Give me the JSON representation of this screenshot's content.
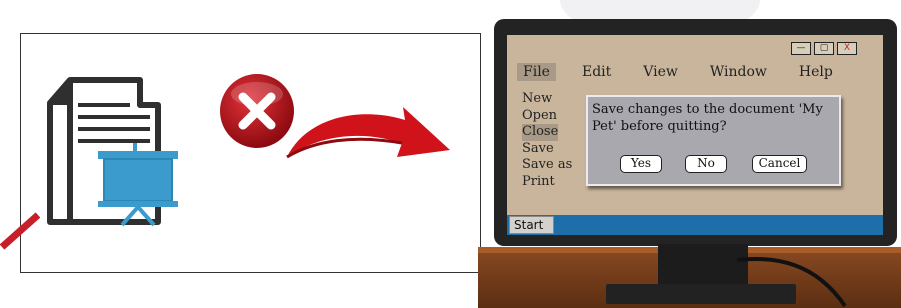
{
  "window_controls": {
    "minimize": "—",
    "maximize": "▢",
    "close": "X"
  },
  "menubar": {
    "items": [
      "File",
      "Edit",
      "View",
      "Window",
      "Help"
    ]
  },
  "file_menu": {
    "items": [
      "New",
      "Open",
      "Close",
      "Save",
      "Save as",
      "Print"
    ],
    "highlighted": "Close"
  },
  "dialog": {
    "message": "Save changes to the document 'My Pet' before quitting?",
    "buttons": {
      "yes": "Yes",
      "no": "No",
      "cancel": "Cancel"
    }
  },
  "taskbar": {
    "start_label": "Start"
  },
  "colors": {
    "screen_bg": "#c9b59b",
    "taskbar": "#1e6fa9",
    "dialog_bg": "#a8a8ae",
    "close_badge": "#b3121b",
    "arrow": "#d0121b",
    "doc_icon": "#2f2f2f",
    "presentation": "#3a9bcc"
  },
  "icons": [
    "document-icon",
    "presentation-icon",
    "close-x-icon",
    "curved-arrow-icon"
  ]
}
